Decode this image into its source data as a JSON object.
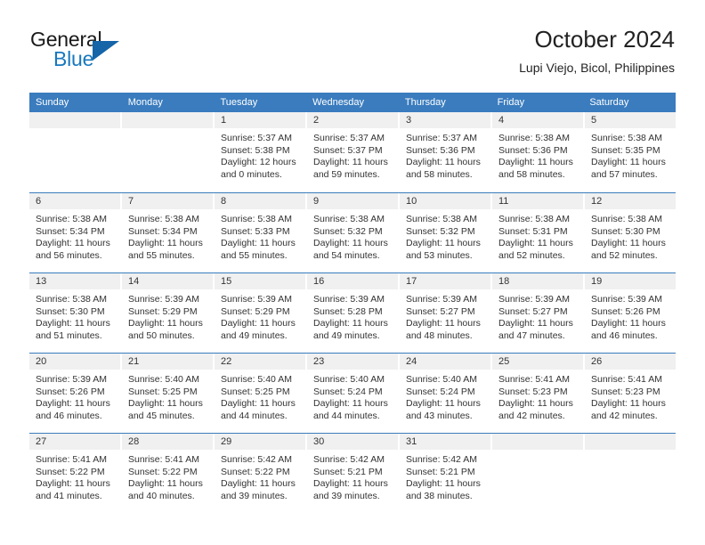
{
  "brand": {
    "name_top": "General",
    "name_bottom": "Blue",
    "triangle_icon": "triangle-icon",
    "accent_color": "#1878be",
    "triangle_color": "#1565a8"
  },
  "header": {
    "title": "October 2024",
    "subtitle": "Lupi Viejo, Bicol, Philippines"
  },
  "calendar": {
    "header_bg_color": "#3a7cbe",
    "day_band_color": "#f0f0f0",
    "weekday_headers": [
      "Sunday",
      "Monday",
      "Tuesday",
      "Wednesday",
      "Thursday",
      "Friday",
      "Saturday"
    ],
    "weeks": [
      [
        {
          "day": "",
          "lines": []
        },
        {
          "day": "",
          "lines": []
        },
        {
          "day": "1",
          "lines": [
            "Sunrise: 5:37 AM",
            "Sunset: 5:38 PM",
            "Daylight: 12 hours",
            "and 0 minutes."
          ]
        },
        {
          "day": "2",
          "lines": [
            "Sunrise: 5:37 AM",
            "Sunset: 5:37 PM",
            "Daylight: 11 hours",
            "and 59 minutes."
          ]
        },
        {
          "day": "3",
          "lines": [
            "Sunrise: 5:37 AM",
            "Sunset: 5:36 PM",
            "Daylight: 11 hours",
            "and 58 minutes."
          ]
        },
        {
          "day": "4",
          "lines": [
            "Sunrise: 5:38 AM",
            "Sunset: 5:36 PM",
            "Daylight: 11 hours",
            "and 58 minutes."
          ]
        },
        {
          "day": "5",
          "lines": [
            "Sunrise: 5:38 AM",
            "Sunset: 5:35 PM",
            "Daylight: 11 hours",
            "and 57 minutes."
          ]
        }
      ],
      [
        {
          "day": "6",
          "lines": [
            "Sunrise: 5:38 AM",
            "Sunset: 5:34 PM",
            "Daylight: 11 hours",
            "and 56 minutes."
          ]
        },
        {
          "day": "7",
          "lines": [
            "Sunrise: 5:38 AM",
            "Sunset: 5:34 PM",
            "Daylight: 11 hours",
            "and 55 minutes."
          ]
        },
        {
          "day": "8",
          "lines": [
            "Sunrise: 5:38 AM",
            "Sunset: 5:33 PM",
            "Daylight: 11 hours",
            "and 55 minutes."
          ]
        },
        {
          "day": "9",
          "lines": [
            "Sunrise: 5:38 AM",
            "Sunset: 5:32 PM",
            "Daylight: 11 hours",
            "and 54 minutes."
          ]
        },
        {
          "day": "10",
          "lines": [
            "Sunrise: 5:38 AM",
            "Sunset: 5:32 PM",
            "Daylight: 11 hours",
            "and 53 minutes."
          ]
        },
        {
          "day": "11",
          "lines": [
            "Sunrise: 5:38 AM",
            "Sunset: 5:31 PM",
            "Daylight: 11 hours",
            "and 52 minutes."
          ]
        },
        {
          "day": "12",
          "lines": [
            "Sunrise: 5:38 AM",
            "Sunset: 5:30 PM",
            "Daylight: 11 hours",
            "and 52 minutes."
          ]
        }
      ],
      [
        {
          "day": "13",
          "lines": [
            "Sunrise: 5:38 AM",
            "Sunset: 5:30 PM",
            "Daylight: 11 hours",
            "and 51 minutes."
          ]
        },
        {
          "day": "14",
          "lines": [
            "Sunrise: 5:39 AM",
            "Sunset: 5:29 PM",
            "Daylight: 11 hours",
            "and 50 minutes."
          ]
        },
        {
          "day": "15",
          "lines": [
            "Sunrise: 5:39 AM",
            "Sunset: 5:29 PM",
            "Daylight: 11 hours",
            "and 49 minutes."
          ]
        },
        {
          "day": "16",
          "lines": [
            "Sunrise: 5:39 AM",
            "Sunset: 5:28 PM",
            "Daylight: 11 hours",
            "and 49 minutes."
          ]
        },
        {
          "day": "17",
          "lines": [
            "Sunrise: 5:39 AM",
            "Sunset: 5:27 PM",
            "Daylight: 11 hours",
            "and 48 minutes."
          ]
        },
        {
          "day": "18",
          "lines": [
            "Sunrise: 5:39 AM",
            "Sunset: 5:27 PM",
            "Daylight: 11 hours",
            "and 47 minutes."
          ]
        },
        {
          "day": "19",
          "lines": [
            "Sunrise: 5:39 AM",
            "Sunset: 5:26 PM",
            "Daylight: 11 hours",
            "and 46 minutes."
          ]
        }
      ],
      [
        {
          "day": "20",
          "lines": [
            "Sunrise: 5:39 AM",
            "Sunset: 5:26 PM",
            "Daylight: 11 hours",
            "and 46 minutes."
          ]
        },
        {
          "day": "21",
          "lines": [
            "Sunrise: 5:40 AM",
            "Sunset: 5:25 PM",
            "Daylight: 11 hours",
            "and 45 minutes."
          ]
        },
        {
          "day": "22",
          "lines": [
            "Sunrise: 5:40 AM",
            "Sunset: 5:25 PM",
            "Daylight: 11 hours",
            "and 44 minutes."
          ]
        },
        {
          "day": "23",
          "lines": [
            "Sunrise: 5:40 AM",
            "Sunset: 5:24 PM",
            "Daylight: 11 hours",
            "and 44 minutes."
          ]
        },
        {
          "day": "24",
          "lines": [
            "Sunrise: 5:40 AM",
            "Sunset: 5:24 PM",
            "Daylight: 11 hours",
            "and 43 minutes."
          ]
        },
        {
          "day": "25",
          "lines": [
            "Sunrise: 5:41 AM",
            "Sunset: 5:23 PM",
            "Daylight: 11 hours",
            "and 42 minutes."
          ]
        },
        {
          "day": "26",
          "lines": [
            "Sunrise: 5:41 AM",
            "Sunset: 5:23 PM",
            "Daylight: 11 hours",
            "and 42 minutes."
          ]
        }
      ],
      [
        {
          "day": "27",
          "lines": [
            "Sunrise: 5:41 AM",
            "Sunset: 5:22 PM",
            "Daylight: 11 hours",
            "and 41 minutes."
          ]
        },
        {
          "day": "28",
          "lines": [
            "Sunrise: 5:41 AM",
            "Sunset: 5:22 PM",
            "Daylight: 11 hours",
            "and 40 minutes."
          ]
        },
        {
          "day": "29",
          "lines": [
            "Sunrise: 5:42 AM",
            "Sunset: 5:22 PM",
            "Daylight: 11 hours",
            "and 39 minutes."
          ]
        },
        {
          "day": "30",
          "lines": [
            "Sunrise: 5:42 AM",
            "Sunset: 5:21 PM",
            "Daylight: 11 hours",
            "and 39 minutes."
          ]
        },
        {
          "day": "31",
          "lines": [
            "Sunrise: 5:42 AM",
            "Sunset: 5:21 PM",
            "Daylight: 11 hours",
            "and 38 minutes."
          ]
        },
        {
          "day": "",
          "lines": []
        },
        {
          "day": "",
          "lines": []
        }
      ]
    ]
  }
}
